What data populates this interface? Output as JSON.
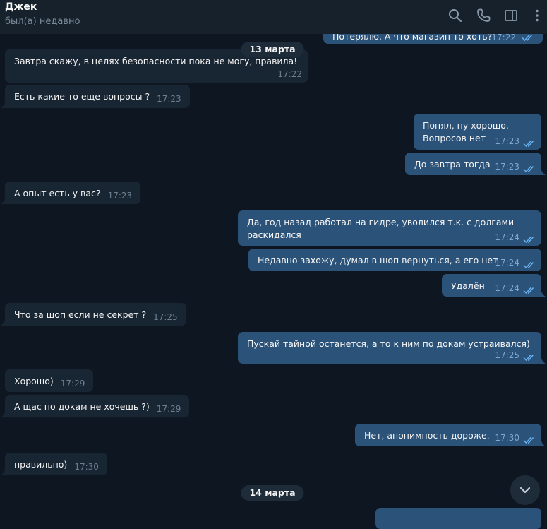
{
  "header": {
    "name": "Джек",
    "status": "был(а) недавно"
  },
  "dates": {
    "march13": "13 марта",
    "march14": "14 марта"
  },
  "messages": [
    {
      "text": "Потерялю. А что магазин то хоть?",
      "time": "17:22"
    },
    {
      "text": "Завтра скажу, в целях безопасности пока не могу, правила!",
      "time": "17:22"
    },
    {
      "text": "Есть какие то еще вопросы ?",
      "time": "17:23"
    },
    {
      "text": "Понял, ну хорошо.\nВопросов нет",
      "time": "17:23"
    },
    {
      "text": "До завтра тогда",
      "time": "17:23"
    },
    {
      "text": "А опыт есть у вас?",
      "time": "17:23"
    },
    {
      "text": "Да, год назад работал на гидре, уволился т.к. с долгами\nраскидался",
      "time": "17:24"
    },
    {
      "text": "Недавно захожу, думал в шоп вернуться, а его нет",
      "time": "17:24"
    },
    {
      "text": "Удалён",
      "time": "17:24"
    },
    {
      "text": "Что за шоп если не секрет ?",
      "time": "17:25"
    },
    {
      "text": "Пускай тайной останется, а то к ним по докам устраивался)",
      "time": "17:25"
    },
    {
      "text": "Хорошо)",
      "time": "17:29"
    },
    {
      "text": "А щас по докам не хочешь ?)",
      "time": "17:29"
    },
    {
      "text": "Нет, анонимность дороже.",
      "time": "17:30"
    },
    {
      "text": "правильно)",
      "time": "17:30"
    }
  ],
  "icons": {
    "search": "search-icon",
    "call": "phone-icon",
    "sidebar": "sidebar-toggle-icon",
    "more": "more-vertical-icon",
    "read": "double-check-icon",
    "scroll": "chevron-down-icon"
  },
  "colors": {
    "background": "#0e1621",
    "header": "#17212b",
    "incoming": "#182533",
    "outgoing": "#2b5278",
    "read_ticks": "#6ab3f3"
  }
}
